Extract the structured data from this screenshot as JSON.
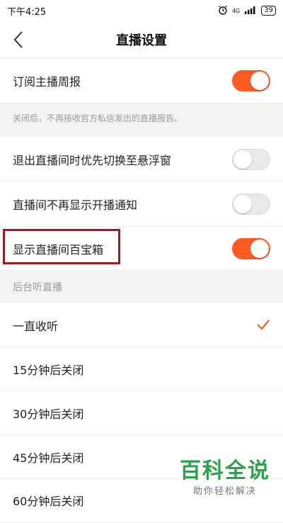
{
  "status_bar": {
    "time": "下午4:25",
    "network": "4G",
    "battery": "39"
  },
  "header": {
    "title": "直播设置"
  },
  "settings": {
    "weekly_report": {
      "label": "订阅主播周报",
      "on": true
    },
    "weekly_report_hint": "关闭后，不再接收官方私信发出的直播报告。",
    "floating_window": {
      "label": "退出直播间时优先切换至悬浮窗",
      "on": false
    },
    "no_start_notice": {
      "label": "直播间不再显示开播通知",
      "on": false
    },
    "treasure_box": {
      "label": "显示直播间百宝箱",
      "on": true
    }
  },
  "background_listen": {
    "section_label": "后台听直播",
    "options": [
      {
        "label": "一直收听",
        "selected": true
      },
      {
        "label": "15分钟后关闭",
        "selected": false
      },
      {
        "label": "30分钟后关闭",
        "selected": false
      },
      {
        "label": "45分钟后关闭",
        "selected": false
      },
      {
        "label": "60分钟后关闭",
        "selected": false
      }
    ]
  },
  "watermark": {
    "title": "百科全说",
    "subtitle": "助你轻松解决"
  },
  "colors": {
    "accent": "#ff5a1f",
    "highlight": "#a51a1a",
    "watermark": "#2fa14d"
  }
}
